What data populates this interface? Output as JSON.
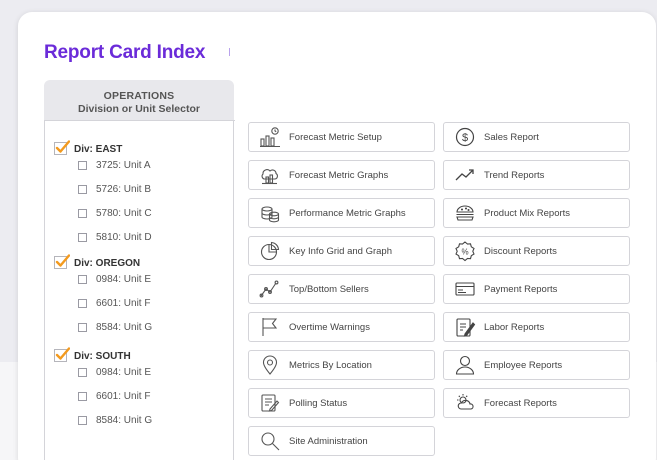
{
  "title": "Report Card Index",
  "colors": {
    "accent": "#6b2bd9",
    "check": "#f39a1e"
  },
  "selector": {
    "heading": "OPERATIONS",
    "subheading": "Division or Unit Selector",
    "divisions": [
      {
        "label": "Div: EAST",
        "checked": true,
        "units": [
          "3725: Unit A",
          "5726: Unit B",
          "5780: Unit C",
          "5810: Unit D"
        ]
      },
      {
        "label": "Div: OREGON",
        "checked": true,
        "units": [
          "0984: Unit E",
          "6601: Unit F",
          "8584: Unit G"
        ]
      },
      {
        "label": "Div: SOUTH",
        "checked": true,
        "units": [
          "0984: Unit E",
          "6601: Unit F",
          "8584: Unit G"
        ]
      }
    ]
  },
  "left_reports": [
    {
      "label": "Forecast Metric Setup",
      "icon": "forecast-setup-icon"
    },
    {
      "label": "Forecast Metric Graphs",
      "icon": "forecast-graphs-icon"
    },
    {
      "label": "Performance Metric Graphs",
      "icon": "coins-icon"
    },
    {
      "label": "Key Info Grid and Graph",
      "icon": "pie-chart-icon"
    },
    {
      "label": "Top/Bottom Sellers",
      "icon": "line-graph-icon"
    },
    {
      "label": "Overtime Warnings",
      "icon": "flag-icon"
    },
    {
      "label": "Metrics By Location",
      "icon": "location-pin-icon"
    },
    {
      "label": "Polling Status",
      "icon": "edit-document-icon"
    },
    {
      "label": "Site Administration",
      "icon": "search-icon"
    }
  ],
  "right_reports": [
    {
      "label": "Sales Report",
      "icon": "dollar-circle-icon"
    },
    {
      "label": "Trend Reports",
      "icon": "trend-icon"
    },
    {
      "label": "Product Mix Reports",
      "icon": "burger-icon"
    },
    {
      "label": "Discount Reports",
      "icon": "percent-badge-icon"
    },
    {
      "label": "Payment Reports",
      "icon": "credit-card-icon"
    },
    {
      "label": "Labor Reports",
      "icon": "clipboard-pen-icon"
    },
    {
      "label": "Employee Reports",
      "icon": "user-icon"
    },
    {
      "label": "Forecast Reports",
      "icon": "weather-icon"
    }
  ]
}
